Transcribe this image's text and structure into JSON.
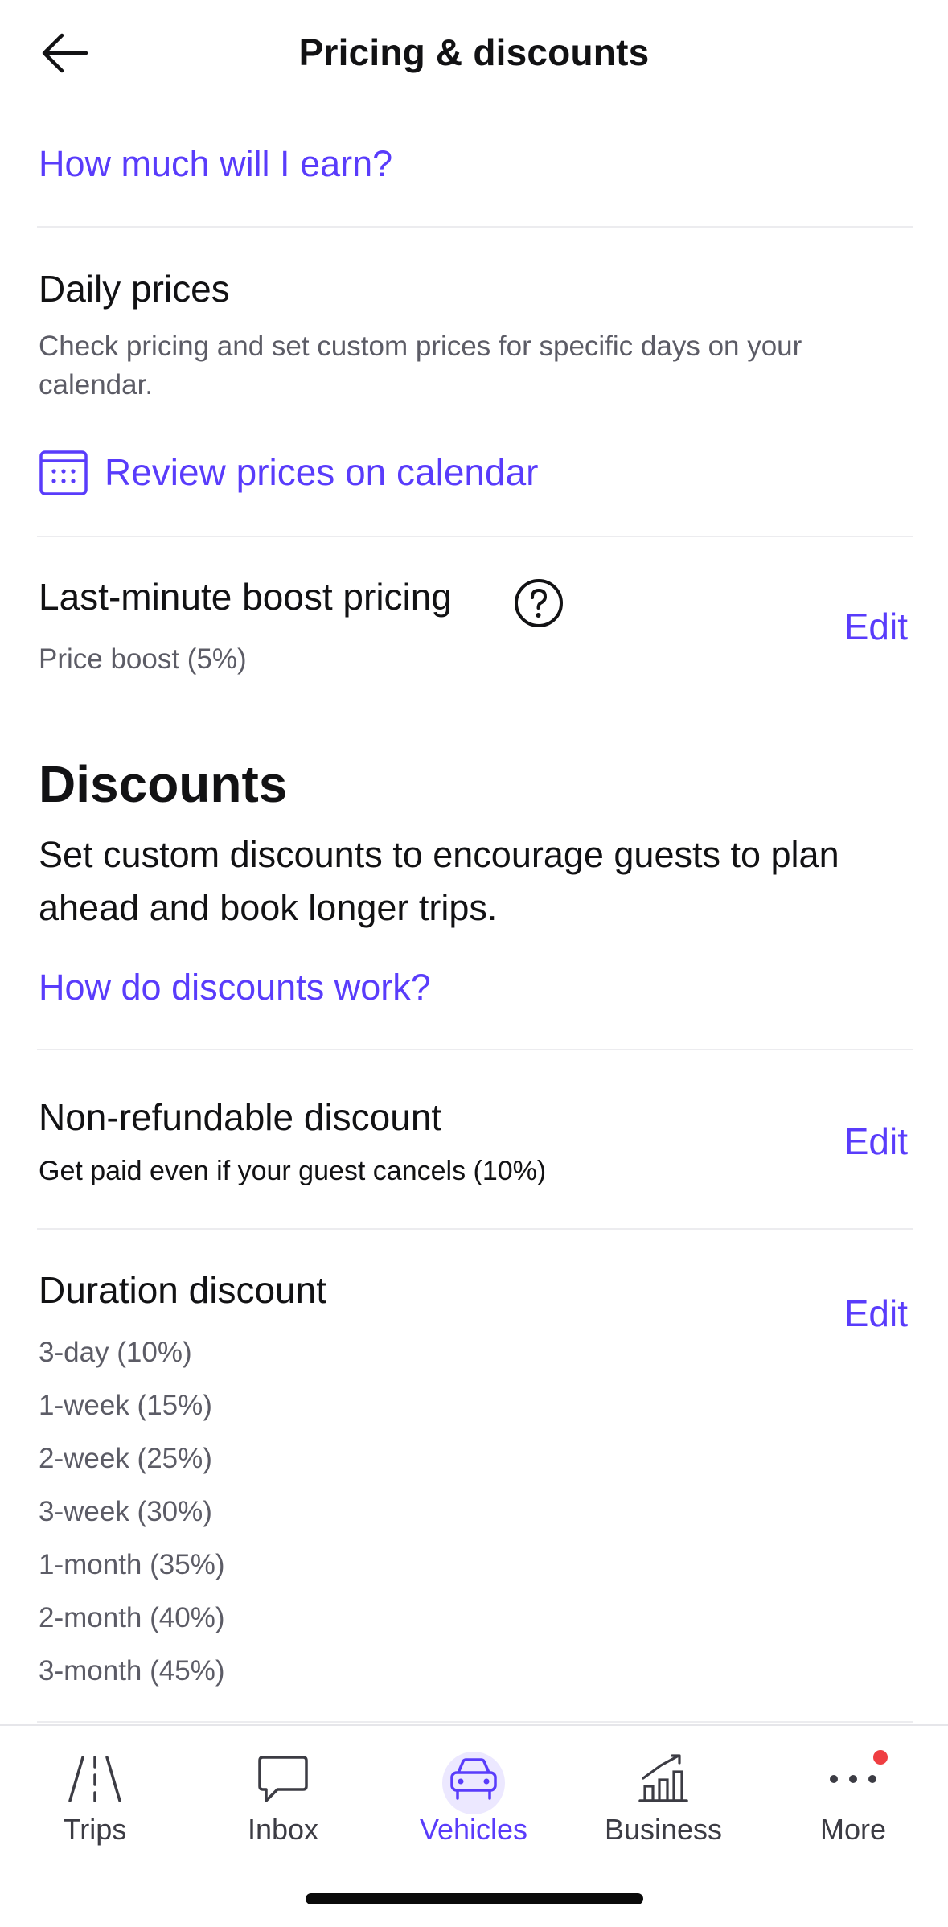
{
  "header": {
    "title": "Pricing & discounts"
  },
  "earn_link": "How much will I earn?",
  "daily_prices": {
    "title": "Daily prices",
    "description": "Check pricing and set custom prices for specific days on your calendar.",
    "calendar_link": "Review prices on calendar"
  },
  "boost": {
    "title": "Last-minute boost pricing",
    "detail": "Price boost (5%)",
    "edit_label": "Edit"
  },
  "discounts": {
    "heading": "Discounts",
    "description": "Set custom discounts to encourage guests to plan ahead and book longer trips.",
    "help_link": "How do discounts work?"
  },
  "non_refundable": {
    "title": "Non-refundable discount",
    "detail": "Get paid even if your guest cancels (10%)",
    "edit_label": "Edit"
  },
  "duration": {
    "title": "Duration discount",
    "edit_label": "Edit",
    "items": [
      "3-day (10%)",
      "1-week (15%)",
      "2-week (25%)",
      "3-week (30%)",
      "1-month (35%)",
      "2-month (40%)",
      "3-month (45%)"
    ]
  },
  "nav": {
    "items": [
      {
        "label": "Trips",
        "icon": "road-icon"
      },
      {
        "label": "Inbox",
        "icon": "chat-bubble-icon"
      },
      {
        "label": "Vehicles",
        "icon": "car-icon",
        "active": true
      },
      {
        "label": "Business",
        "icon": "bar-chart-icon"
      },
      {
        "label": "More",
        "icon": "more-dots-icon",
        "badge": true
      }
    ]
  },
  "colors": {
    "accent": "#593cfb",
    "badge": "#ef3e42",
    "text": "#121214",
    "muted": "#5c5c66"
  }
}
